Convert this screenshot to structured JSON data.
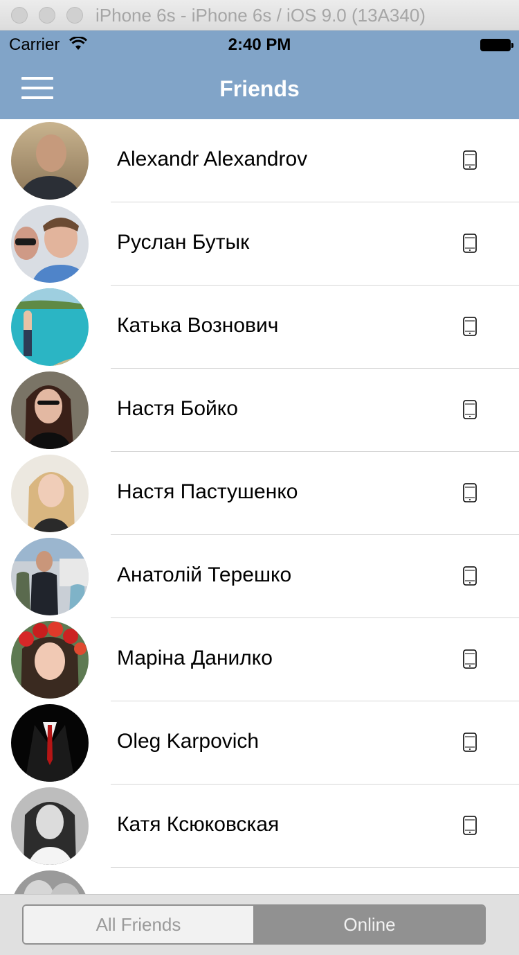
{
  "window": {
    "title": "iPhone 6s - iPhone 6s / iOS 9.0 (13A340)"
  },
  "status_bar": {
    "carrier": "Carrier",
    "time": "2:40 PM"
  },
  "nav": {
    "title": "Friends",
    "menu_icon": "hamburger-menu-icon"
  },
  "colors": {
    "nav_background": "#81a4c8",
    "segment_selected": "#919191"
  },
  "friends": [
    {
      "name": "Alexandr Alexandrov",
      "device_icon": "mobile-phone-icon"
    },
    {
      "name": "Руслан Бутык",
      "device_icon": "mobile-phone-icon"
    },
    {
      "name": "Катька Вознович",
      "device_icon": "mobile-phone-icon"
    },
    {
      "name": "Настя Бойко",
      "device_icon": "mobile-phone-icon"
    },
    {
      "name": "Настя Пастушенко",
      "device_icon": "mobile-phone-icon"
    },
    {
      "name": "Анатолій Терешко",
      "device_icon": "mobile-phone-icon"
    },
    {
      "name": "Маріна Данилко",
      "device_icon": "mobile-phone-icon"
    },
    {
      "name": "Oleg Karpovich",
      "device_icon": "mobile-phone-icon"
    },
    {
      "name": "Катя Ксюковская",
      "device_icon": "mobile-phone-icon"
    },
    {
      "name": "",
      "device_icon": ""
    }
  ],
  "segmented_control": {
    "options": [
      "All Friends",
      "Online"
    ],
    "selected": "Online"
  }
}
